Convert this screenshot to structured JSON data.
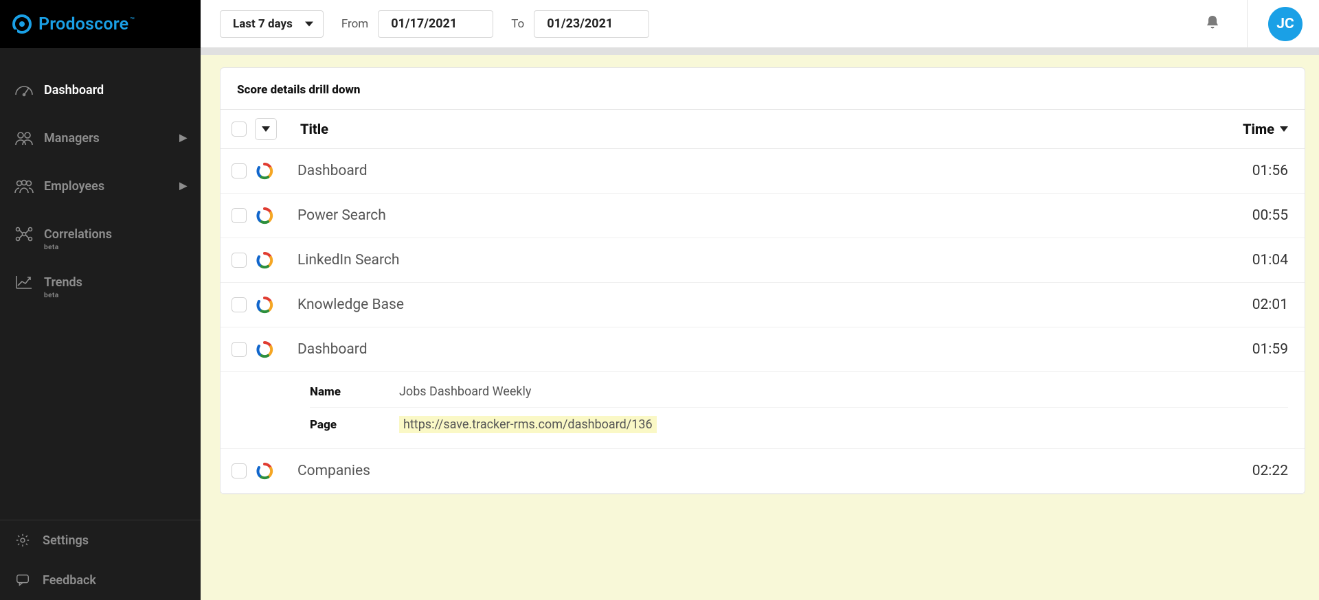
{
  "brand": {
    "name": "Prodoscore",
    "tm": "™"
  },
  "sidebar": {
    "items": [
      {
        "label": "Dashboard",
        "icon": "gauge-icon",
        "active": true
      },
      {
        "label": "Managers",
        "icon": "people-pair-icon",
        "chevron": true
      },
      {
        "label": "Employees",
        "icon": "people-group-icon",
        "chevron": true
      },
      {
        "label": "Correlations",
        "icon": "network-icon",
        "beta": "beta"
      },
      {
        "label": "Trends",
        "icon": "trend-chart-icon",
        "beta": "beta"
      }
    ],
    "footer": [
      {
        "label": "Settings",
        "icon": "gear-icon"
      },
      {
        "label": "Feedback",
        "icon": "chat-icon"
      }
    ]
  },
  "topbar": {
    "range": "Last 7 days",
    "from_label": "From",
    "from_value": "01/17/2021",
    "to_label": "To",
    "to_value": "01/23/2021",
    "avatar": "JC"
  },
  "panel": {
    "title": "Score details drill down",
    "columns": {
      "title": "Title",
      "time": "Time"
    },
    "rows": [
      {
        "title": "Dashboard",
        "time": "01:56"
      },
      {
        "title": "Power Search",
        "time": "00:55"
      },
      {
        "title": "LinkedIn Search",
        "time": "01:04"
      },
      {
        "title": "Knowledge Base",
        "time": "02:01"
      },
      {
        "title": "Dashboard",
        "time": "01:59",
        "details": {
          "name_key": "Name",
          "name_val": "Jobs Dashboard Weekly",
          "page_key": "Page",
          "page_val": "https://save.tracker-rms.com/dashboard/136"
        }
      },
      {
        "title": "Companies",
        "time": "02:22"
      }
    ]
  }
}
